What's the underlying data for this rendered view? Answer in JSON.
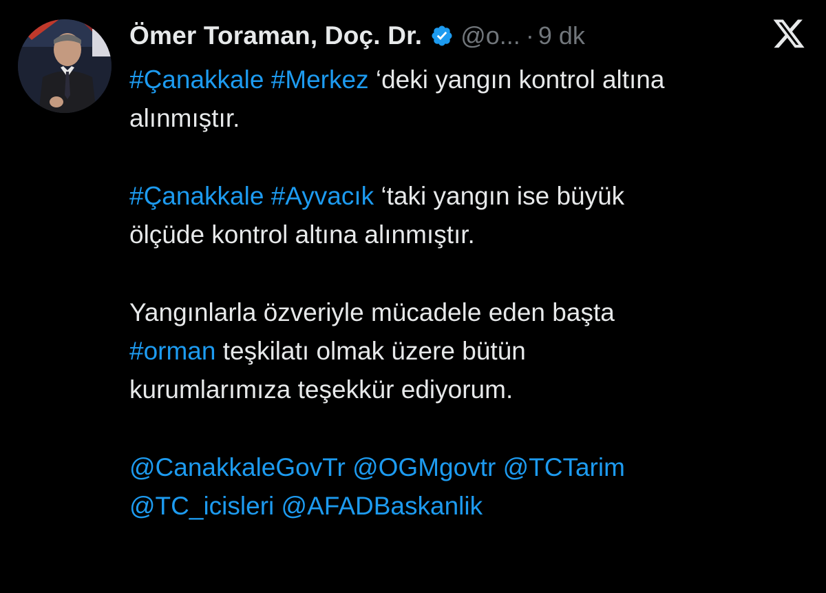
{
  "tweet": {
    "author": {
      "display_name": "Ömer Toraman, Doç. Dr.",
      "handle": "@o...",
      "separator": "·",
      "time": "9 dk",
      "verified_icon": "verified-badge-icon"
    },
    "platform_icon": "x-logo-icon",
    "paragraphs": {
      "p1": {
        "tag1": "#Çanakkale",
        "tag2": "#Merkez",
        "text_line1": " ‘deki yangın kontrol altına",
        "text_line2": "alınmıştır."
      },
      "p2": {
        "tag1": "#Çanakkale",
        "tag2": "#Ayvacık",
        "text_line1": " ‘taki yangın ise büyük",
        "text_line2": "ölçüde kontrol altına alınmıştır."
      },
      "p3": {
        "line1": "Yangınlarla özveriyle mücadele eden başta",
        "tag": "#orman",
        "line2_rest": " teşkilatı olmak üzere bütün",
        "line3": "kurumlarımıza teşekkür ediyorum."
      },
      "p4": {
        "mention1": "@CanakkaleGovTr",
        "mention2": "@OGMgovtr",
        "mention3": "@TCTarim",
        "mention4": "@TC_icisleri",
        "mention5": "@AFADBaskanlik"
      }
    },
    "colors": {
      "background": "#000000",
      "text": "#e7e9ea",
      "secondary_text": "#71767b",
      "link": "#1d9bf0"
    }
  }
}
